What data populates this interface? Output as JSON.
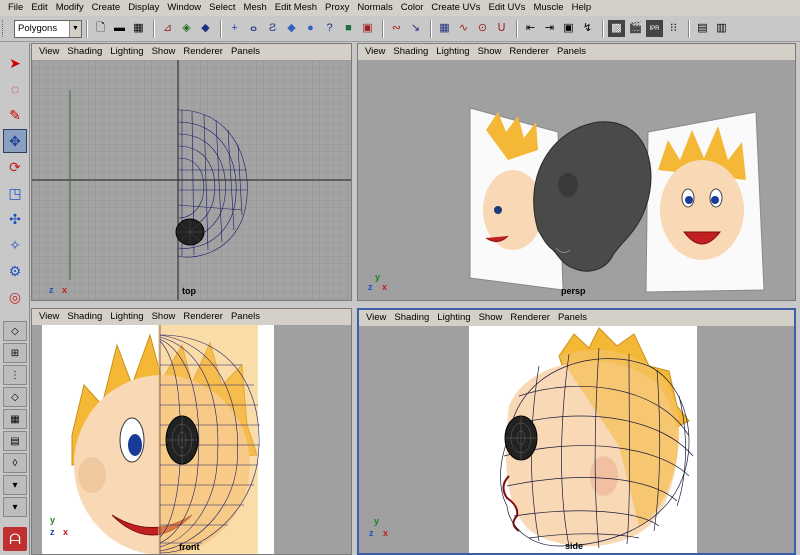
{
  "menubar": {
    "items": [
      "File",
      "Edit",
      "Modify",
      "Create",
      "Display",
      "Window",
      "Select",
      "Mesh",
      "Edit Mesh",
      "Proxy",
      "Normals",
      "Color",
      "Create UVs",
      "Edit UVs",
      "Muscle",
      "Help"
    ]
  },
  "shelf": {
    "mode_value": "Polygons",
    "icons": [
      "new-scene-icon",
      "open-scene-icon",
      "save-scene-icon",
      "select-by-hierarchy-icon",
      "select-by-object-icon",
      "select-by-component-icon",
      "snap-grid-icon",
      "snap-curve-icon",
      "snap-point-icon",
      "snap-plane-icon",
      "make-live-icon",
      "history-icon",
      "render-icon",
      "ipr-render-icon",
      "render-settings-icon"
    ]
  },
  "panels": [
    {
      "id": "top",
      "menu": [
        "View",
        "Shading",
        "Lighting",
        "Show",
        "Renderer",
        "Panels"
      ],
      "camera": "top",
      "axes": [
        "z",
        "x"
      ]
    },
    {
      "id": "persp",
      "menu": [
        "View",
        "Shading",
        "Lighting",
        "Show",
        "Renderer",
        "Panels"
      ],
      "camera": "persp",
      "axes": [
        "y",
        "z",
        "x"
      ]
    },
    {
      "id": "front",
      "menu": [
        "View",
        "Shading",
        "Lighting",
        "Show",
        "Renderer",
        "Panels"
      ],
      "camera": "front",
      "axes": [
        "y",
        "z",
        "x"
      ]
    },
    {
      "id": "side",
      "menu": [
        "View",
        "Shading",
        "Lighting",
        "Show",
        "Renderer",
        "Panels"
      ],
      "camera": "side",
      "axes": [
        "y",
        "z",
        "x"
      ]
    }
  ],
  "colors": {
    "viewport_bg": "#a0a0a0",
    "grid_line": "#8e8e8e",
    "wireframe": "#1a1a6a",
    "active_panel": "#3a5ea8",
    "hair": "#f5b836",
    "skin": "#f9d9b5"
  }
}
